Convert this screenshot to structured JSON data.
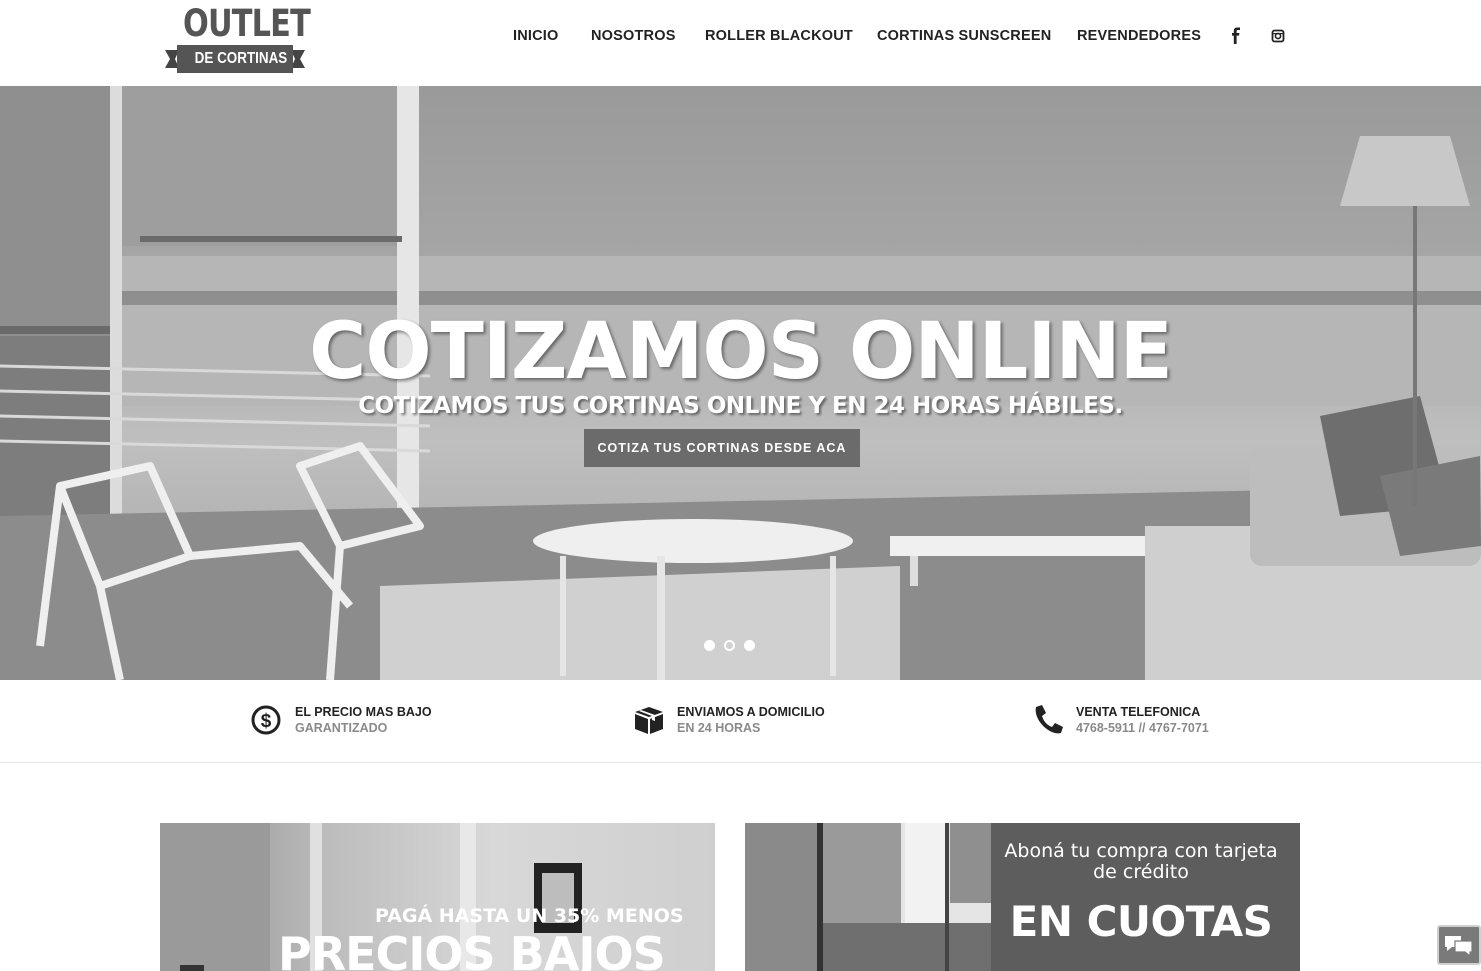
{
  "header": {
    "logo": {
      "top": "OUTLET",
      "bottom": "DE CORTINAS"
    },
    "nav": [
      {
        "label": "INICIO"
      },
      {
        "label": "NOSOTROS"
      },
      {
        "label": "ROLLER BLACKOUT"
      },
      {
        "label": "CORTINAS SUNSCREEN"
      },
      {
        "label": "REVENDEDORES"
      }
    ],
    "social": {
      "facebook_icon": "facebook-icon",
      "instagram_icon": "instagram-icon"
    }
  },
  "hero": {
    "title": "COTIZAMOS ONLINE",
    "subtitle": "COTIZAMOS TUS CORTINAS ONLINE Y EN 24 HORAS HÁBILES.",
    "button": "COTIZA TUS CORTINAS DESDE ACA",
    "slides": {
      "count": 3,
      "active": 2
    }
  },
  "features": [
    {
      "icon": "dollar-icon",
      "title": "EL PRECIO MAS BAJO",
      "subtitle": "GARANTIZADO"
    },
    {
      "icon": "box-icon",
      "title": "ENVIAMOS A DOMICILIO",
      "subtitle": "EN 24 HORAS"
    },
    {
      "icon": "phone-icon",
      "title": "VENTA TELEFONICA",
      "subtitle": "4768-5911 // 4767-7071"
    }
  ],
  "promos": {
    "left": {
      "small": "PAGÁ HASTA UN 35% MENOS",
      "big": "PRECIOS BAJOS"
    },
    "right": {
      "line1": "Aboná tu compra con tarjeta de crédito",
      "big": "EN CUOTAS"
    }
  },
  "chat": {
    "icon": "chat-icon"
  },
  "colors": {
    "accent": "#6b6b6b",
    "text": "#222222",
    "muted": "#8a8a8a"
  }
}
